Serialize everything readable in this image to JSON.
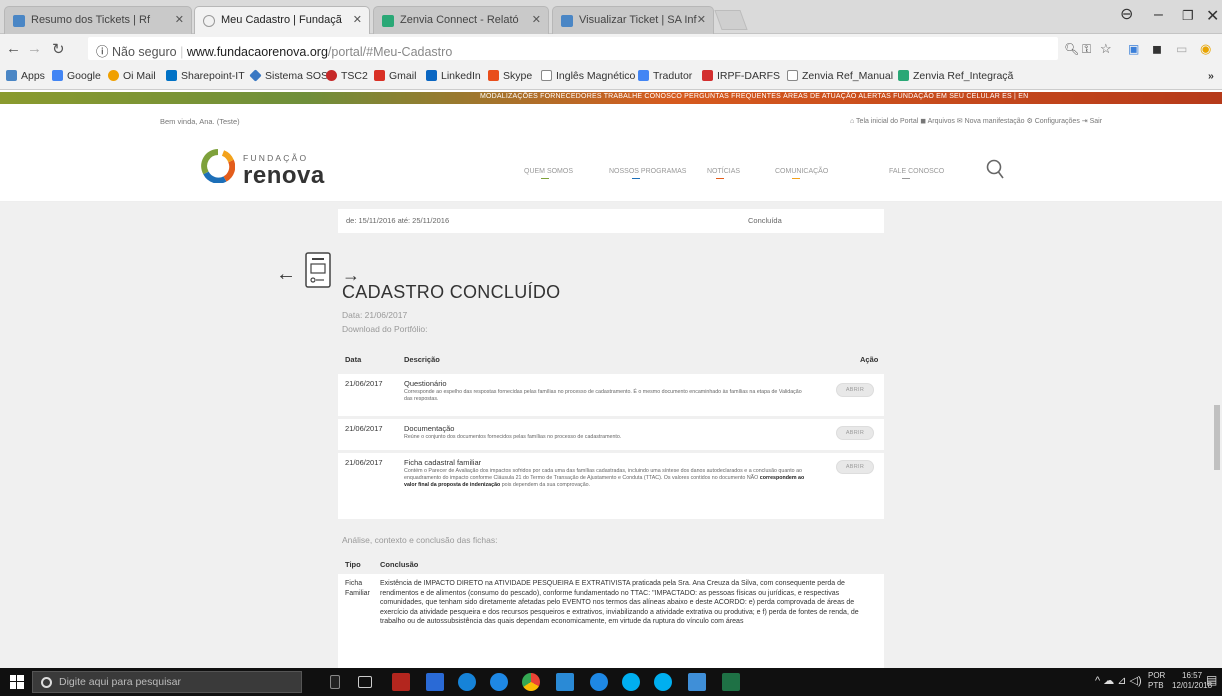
{
  "browser": {
    "tabs": [
      {
        "label": "Resumo dos Tickets | Rf",
        "color": "#4a86c5",
        "active": false
      },
      {
        "label": "Meu Cadastro | Fundaçã",
        "color": "#999999",
        "active": true
      },
      {
        "label": "Zenvia Connect - Relató",
        "color": "#2aa876",
        "active": false
      },
      {
        "label": "Visualizar Ticket | SA Inf",
        "color": "#4a86c5",
        "active": false
      }
    ],
    "security_label": "Não seguro",
    "url_host": "www.fundacaorenova.org",
    "url_path": "/portal/#Meu-Cadastro",
    "bookmarks": [
      {
        "label": "Apps",
        "color": "#4a86c5"
      },
      {
        "label": "Google",
        "color": "#4285f4"
      },
      {
        "label": "Oi Mail",
        "color": "#f0a000"
      },
      {
        "label": "Sharepoint-IT",
        "color": "#0072c6"
      },
      {
        "label": "Sistema SOS",
        "color": "#3a78c3"
      },
      {
        "label": "TSC2",
        "color": "#c62828"
      },
      {
        "label": "Gmail",
        "color": "#d93025"
      },
      {
        "label": "LinkedIn",
        "color": "#0a66c2"
      },
      {
        "label": "Skype",
        "color": "#e94e1b"
      },
      {
        "label": "Inglês Magnético",
        "color": "#888888"
      },
      {
        "label": "Tradutor",
        "color": "#4285f4"
      },
      {
        "label": "IRPF-DARFS",
        "color": "#d32f2f"
      },
      {
        "label": "Zenvia Ref_Manual",
        "color": "#888888"
      },
      {
        "label": "Zenvia Ref_Integraçã",
        "color": "#2aa876"
      }
    ]
  },
  "site": {
    "stripe_links": "MODALIZAÇÕES  FORNECEDORES  TRABALHE CONOSCO  PERGUNTAS FREQUENTES  ÁREAS DE ATUAÇÃO  ALERTAS FUNDAÇÃO EM SEU CELULAR  ES | EN",
    "welcome": "Bem vinda, Ana. (Teste)",
    "top_links": "⌂ Tela inicial do Portal   ◼ Arquivos   ✉ Nova manifestação   ⚙ Configurações   ⇥ Sair",
    "logo_small": "FUNDAÇÃO",
    "logo_big": "renova",
    "menu": [
      "QUEM SOMOS",
      "NOSSOS PROGRAMAS",
      "NOTÍCIAS",
      "COMUNICAÇÃO",
      "FALE CONOSCO"
    ]
  },
  "content": {
    "prev_row_date": "de: 15/11/2016 até: 25/11/2016",
    "prev_row_status": "Concluída",
    "title": "CADASTRO CONCLUÍDO",
    "date": "Data: 21/06/2017",
    "download_label": "Download do Portfólio:",
    "table_headers": {
      "date": "Data",
      "desc": "Descrição",
      "action": "Ação"
    },
    "rows": [
      {
        "date": "21/06/2017",
        "title": "Questionário",
        "desc": "Corresponde ao espelho das respostas fornecidas pelas famílias no processo de cadastramento. É o mesmo documento encaminhado às famílias na etapa de Validação das respostas.",
        "action": "ABRIR"
      },
      {
        "date": "21/06/2017",
        "title": "Documentação",
        "desc": "Reúne o conjunto dos documentos fornecidos pelas famílias no processo de cadastramento.",
        "action": "ABRIR"
      },
      {
        "date": "21/06/2017",
        "title": "Ficha cadastral familiar",
        "desc": "Contém o Parecer de Avaliação dos impactos sofridos por cada uma das famílias cadastradas, incluindo uma síntese dos danos autodeclarados e a conclusão quanto ao enquadramento do impacto conforme Cláusula 21 do Termo de Transação de Ajustamento e Conduta (TTAC). Os valores contidos no documento NÃO",
        "desc_bold": "correspondem ao valor final da proposta de indenização",
        "desc_tail": "pois dependem da sua comprovação.",
        "action": "ABRIR"
      }
    ],
    "analysis_label": "Análise, contexto e conclusão das fichas:",
    "analysis_headers": {
      "type": "Tipo",
      "conclusion": "Conclusão"
    },
    "analysis_type": "Ficha Familiar",
    "analysis_text": "Existência de IMPACTO DIRETO na ATIVIDADE PESQUEIRA E EXTRATIVISTA praticada pela Sra. Ana Creuza da Silva, com consequente perda de rendimentos e de alimentos (consumo do pescado), conforme fundamentado no TTAC: \"IMPACTADO: as pessoas físicas ou jurídicas, e respectivas comunidades, que tenham sido diretamente afetadas pelo EVENTO nos termos das alíneas abaixo e deste ACORDO: e) perda comprovada de áreas de exercício da atividade pesqueira e dos recursos pesqueiros e extrativos, inviabilizando a atividade extrativa ou produtiva; e f) perda de fontes de renda, de trabalho ou de autossubsistência das quais dependam economicamente, em virtude da ruptura do vínculo com áreas"
  },
  "taskbar": {
    "search_placeholder": "Digite aqui para pesquisar",
    "lang": "POR",
    "lang2": "PTB",
    "time": "16:57",
    "date": "12/01/2018"
  }
}
